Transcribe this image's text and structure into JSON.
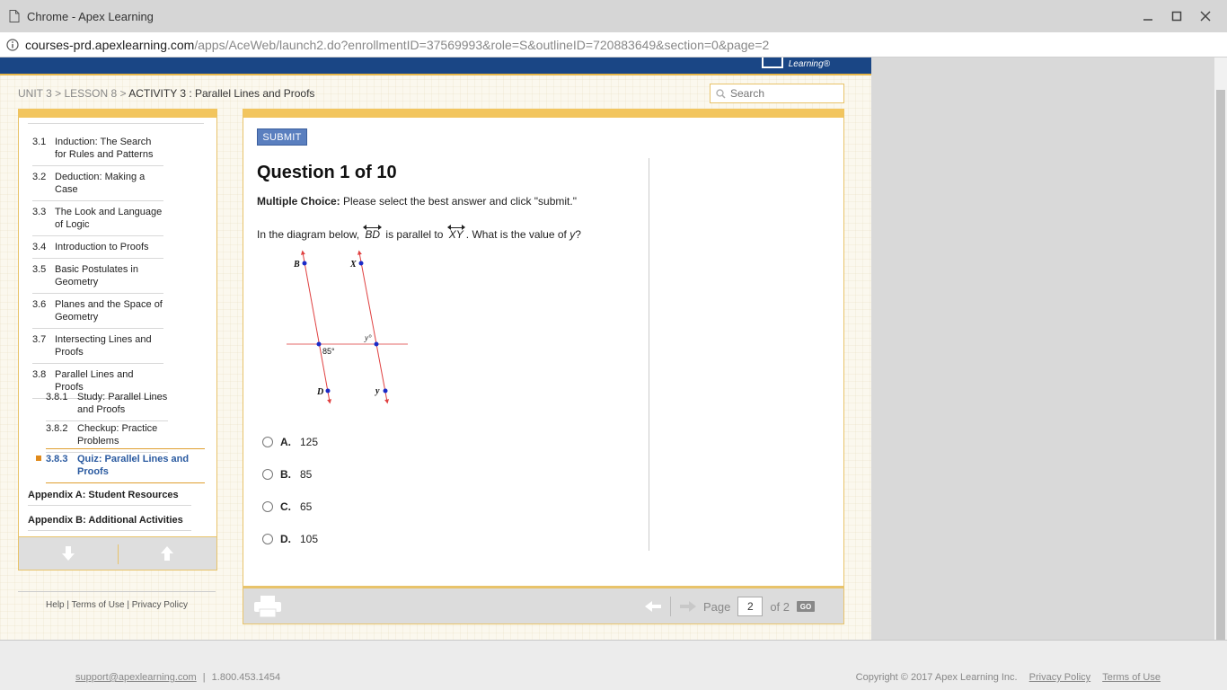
{
  "window": {
    "title": "Chrome - Apex Learning"
  },
  "address": {
    "host": "courses-prd.apexlearning.com",
    "path": "/apps/AceWeb/launch2.do?enrollmentID=37569993&role=S&outlineID=720883649&section=0&page=2"
  },
  "header": {
    "logo_text": "Learning®"
  },
  "breadcrumb": {
    "unit": "UNIT 3",
    "sep1": " > ",
    "lesson": "LESSON 8",
    "sep2": " > ",
    "activity": "ACTIVITY 3 : Parallel Lines and Proofs"
  },
  "search": {
    "placeholder": "Search"
  },
  "sidebar": {
    "items": [
      {
        "num": "3.1",
        "label": "Induction: The Search for Rules and Patterns"
      },
      {
        "num": "3.2",
        "label": "Deduction: Making a Case"
      },
      {
        "num": "3.3",
        "label": "The Look and Language of Logic"
      },
      {
        "num": "3.4",
        "label": "Introduction to Proofs"
      },
      {
        "num": "3.5",
        "label": "Basic Postulates in Geometry"
      },
      {
        "num": "3.6",
        "label": "Planes and the Space of Geometry"
      },
      {
        "num": "3.7",
        "label": "Intersecting Lines and Proofs"
      },
      {
        "num": "3.8",
        "label": "Parallel Lines and Proofs"
      }
    ],
    "subitems": [
      {
        "num": "3.8.1",
        "label": "Study: Parallel Lines and Proofs"
      },
      {
        "num": "3.8.2",
        "label": "Checkup: Practice Problems"
      },
      {
        "num": "3.8.3",
        "label": "Quiz: Parallel Lines and Proofs"
      }
    ],
    "appendices": [
      "Appendix A: Student Resources",
      "Appendix B: Additional Activities"
    ]
  },
  "help_links": {
    "help": "Help",
    "terms": "Terms of Use",
    "privacy": "Privacy Policy",
    "sep": "|"
  },
  "question": {
    "submit_label": "SUBMIT",
    "title": "Question 1 of 10",
    "instr_bold": "Multiple Choice:",
    "instr_text": " Please select the best answer and click \"submit.\"",
    "text_part1": "In the diagram below, ",
    "segment1": "BD",
    "text_part2": " is parallel to ",
    "segment2": "XY",
    "text_part3": ". What is the value of ",
    "variable": "y",
    "text_part4": "?",
    "diagram_labels": {
      "b": "B",
      "x": "X",
      "d": "D",
      "y": "y",
      "angle85": "85°",
      "angley": "y°"
    },
    "options": [
      {
        "letter": "A.",
        "value": "125"
      },
      {
        "letter": "B.",
        "value": "85"
      },
      {
        "letter": "C.",
        "value": "65"
      },
      {
        "letter": "D.",
        "value": "105"
      }
    ]
  },
  "pager": {
    "page_label": "Page",
    "current": "2",
    "of_label": "of 2",
    "go_label": "GO"
  },
  "footer": {
    "email": "support@apexlearning.com",
    "sep": "|",
    "phone": "1.800.453.1454",
    "copyright": "Copyright © 2017 Apex Learning Inc.",
    "privacy": "Privacy Policy",
    "terms": "Terms of Use"
  },
  "colors": {
    "accent_blue": "#1a4685",
    "accent_gold": "#f2c55e",
    "line_red": "#e04040",
    "point_blue": "#1a2ac8"
  }
}
